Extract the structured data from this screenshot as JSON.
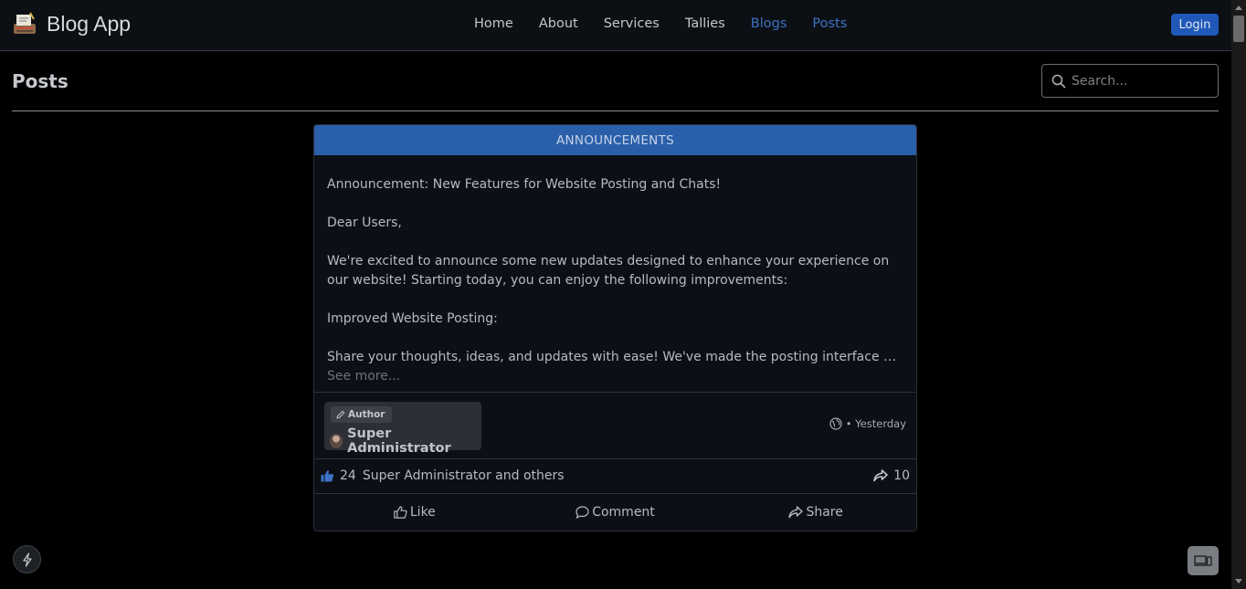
{
  "brand": {
    "title": "Blog App"
  },
  "nav": {
    "links": [
      {
        "label": "Home"
      },
      {
        "label": "About"
      },
      {
        "label": "Services"
      },
      {
        "label": "Tallies"
      },
      {
        "label": "Blogs"
      },
      {
        "label": "Posts"
      }
    ],
    "login_label": "Login"
  },
  "page": {
    "title": "Posts",
    "search_placeholder": "Search..."
  },
  "post": {
    "category": "ANNOUNCEMENTS",
    "paragraphs": [
      "Announcement: New Features for Website Posting and Chats!",
      "Dear Users,",
      "We're excited to announce some new updates designed to enhance your experience on our website! Starting today, you can enjoy the following improvements:",
      "Improved Website Posting:",
      "Share your thoughts, ideas, and updates with ease! We've made the posting interface more user..."
    ],
    "see_more": "See more...",
    "author_tag": "Author",
    "author_name": "Super Administrator",
    "time": "• Yesterday",
    "likes_count": "24",
    "likes_text": "Super Administrator and others",
    "shares_count": "10",
    "actions": {
      "like": "Like",
      "comment": "Comment",
      "share": "Share"
    }
  },
  "icons": {
    "brand": "typewriter-logo-icon",
    "search": "search-icon",
    "globe": "globe-icon",
    "like": "thumbs-up-icon",
    "comment": "comment-icon",
    "share": "share-arrow-icon",
    "pencil": "pencil-icon",
    "bolt": "lightning-icon",
    "devices": "devices-icon"
  },
  "colors": {
    "accent": "#2a5faa",
    "active_link": "#3d72c4",
    "login_button": "#1f58b8"
  }
}
